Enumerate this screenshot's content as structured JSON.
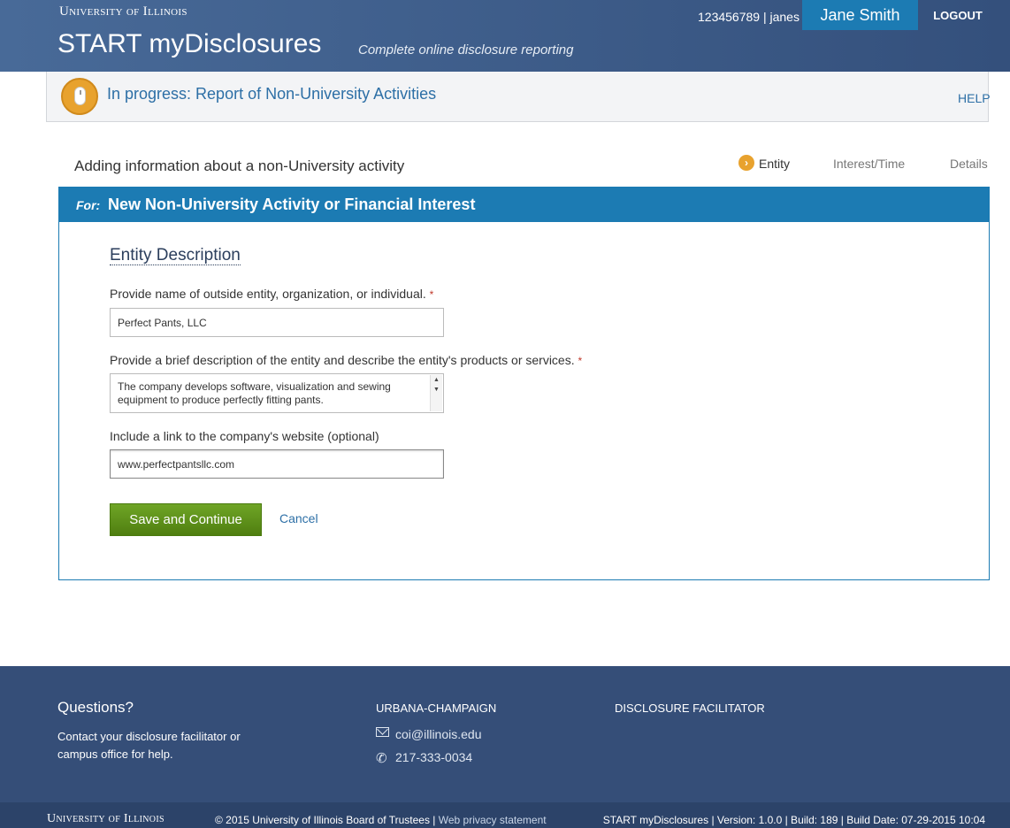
{
  "header": {
    "university": "University of Illinois",
    "app_title": "START myDisclosures",
    "tagline": "Complete online disclosure reporting",
    "user_id_text": "123456789 | janes",
    "user_name": "Jane Smith",
    "logout_label": "LOGOUT"
  },
  "status_bar": {
    "text": "In progress: Report of Non-University Activities",
    "help_label": "HELP"
  },
  "wizard": {
    "heading": "Adding information about a non-University activity",
    "steps": [
      {
        "label": "Entity",
        "active": true
      },
      {
        "label": "Interest/Time",
        "active": false
      },
      {
        "label": "Details",
        "active": false
      }
    ],
    "active_step_icon": "chevron-right-icon"
  },
  "panel": {
    "for_label": "For:",
    "title": "New Non-University Activity or Financial Interest",
    "section_title": "Entity Description",
    "fields": {
      "name": {
        "label": "Provide name of outside entity, organization, or individual.",
        "required_marker": "*",
        "value": "Perfect Pants, LLC"
      },
      "description": {
        "label": "Provide a brief description of the entity and describe the entity's products or services.",
        "required_marker": "*",
        "value": "The company develops software, visualization and sewing equipment to produce perfectly fitting pants."
      },
      "website": {
        "label": "Include a link to the company's website (optional)",
        "value": "www.perfectpantsllc.com"
      }
    },
    "save_label": "Save and Continue",
    "cancel_label": "Cancel"
  },
  "footer": {
    "questions_title": "Questions?",
    "contact_text": "Contact your disclosure facilitator or campus office for help.",
    "campus_title": "URBANA-CHAMPAIGN",
    "email": "coi@illinois.edu",
    "phone": "217-333-0034",
    "facilitator_title": "DISCLOSURE FACILITATOR",
    "bottom_university": "University of Illinois",
    "copyright": "© 2015 University of Illinois Board of Trustees |",
    "privacy_link": "Web privacy statement",
    "build_info": "START myDisclosures | Version: 1.0.0 | Build: 189 | Build Date: 07-29-2015 10:04"
  },
  "colors": {
    "header_bg": "#3f5d8b",
    "accent_blue": "#1c7bb3",
    "status_orange": "#e8a22e",
    "save_green": "#5e9118",
    "footer_bg": "#354e78"
  }
}
